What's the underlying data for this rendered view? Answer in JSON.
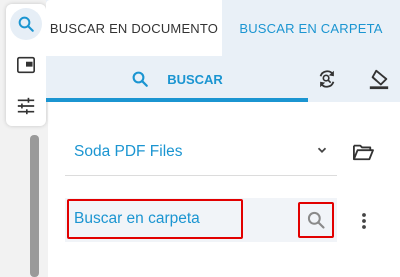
{
  "tabs": {
    "document_label": "BUSCAR EN DOCUMENTO",
    "folder_label": "BUSCAR EN CARPETA"
  },
  "actions": {
    "search_label": "BUSCAR",
    "search_icon": "search-icon",
    "refresh_icon": "refresh-search-icon",
    "clear_icon": "eraser-icon"
  },
  "folder_select": {
    "selected": "Soda PDF Files"
  },
  "search": {
    "placeholder": "Buscar en carpeta"
  },
  "rail": {
    "items": [
      "search-icon",
      "panel-icon",
      "settings-sliders-icon"
    ]
  },
  "colors": {
    "accent": "#1b95d1",
    "highlight_border": "#e20000",
    "tab_bar_bg": "#e9f0f7"
  }
}
